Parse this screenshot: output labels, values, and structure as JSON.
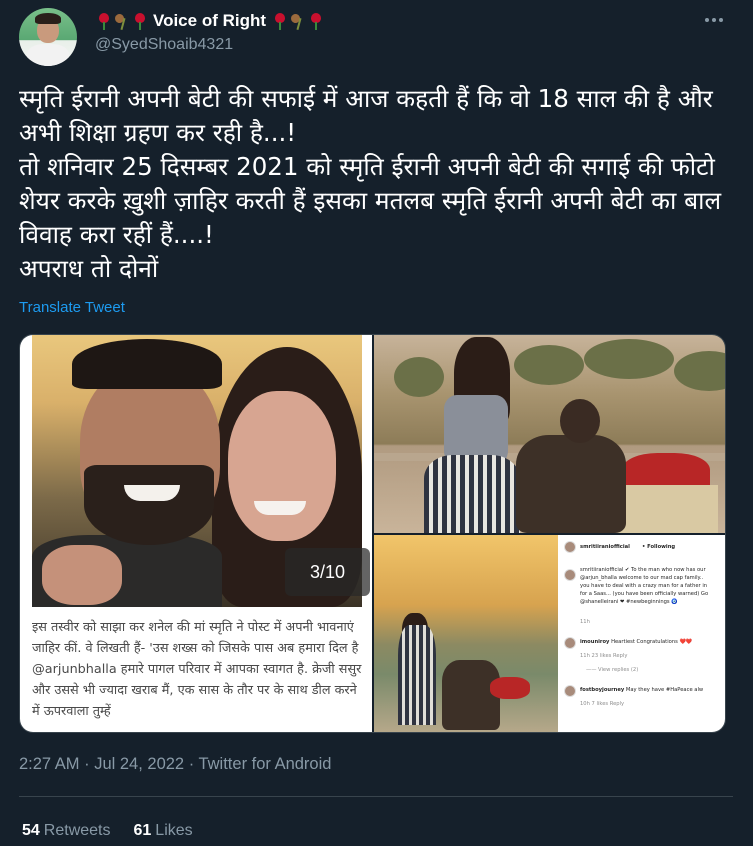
{
  "author": {
    "display_name": "Voice of Right",
    "handle": "@SyedShoaib4321",
    "name_emojis_left": [
      "rose",
      "wilted-flower",
      "rose"
    ],
    "name_emojis_right": [
      "rose",
      "wilted-flower",
      "rose"
    ]
  },
  "tweet": {
    "text": "स्मृति ईरानी अपनी बेटी की सफाई में आज कहती हैं कि वो 18 साल की है और अभी शिक्षा ग्रहण कर रही है...!\nतो शनिवार 25 दिसम्बर 2021 को स्मृति ईरानी अपनी बेटी की सगाई की फोटो शेयर करके ख़ुशी ज़ाहिर करती हैं इसका मतलब स्मृति ईरानी अपनी बेटी का बाल विवाह करा रहीं हैं....!\nअपराध तो दोनों",
    "translate_label": "Translate Tweet"
  },
  "media": {
    "photo_counter": "3/10",
    "caption": "इस तस्वीर को साझा कर शनेल की मां स्मृति ने पोस्ट में अपनी भावनाएं जाहिर कीं. वे लिखती हैं- 'उस शख्स को जिसके पास अब हमारा दिल है @arjunbhalla हमारे पागल परिवार में आपका स्वागत है. क्रेजी ससुर और उससे भी ज्यादा खराब मैं, एक सास के तौर पर  के साथ डील करने में ऊपरवाला तुम्हें",
    "instagram": {
      "account": "smritiiraniofficial",
      "following": "• Following",
      "post_lines": [
        "smritiiraniofficial ✔ To the man who now has our",
        "@arjun_bhalla welcome to our mad cap family..",
        "you have to deal with a crazy man for a father in",
        "for a Saas... (you have been officially warned) Go",
        "@shanelleirani ❤ #newbeginnings 🧿"
      ],
      "post_time": "11h",
      "comments": [
        {
          "user": "imouniroy",
          "text": "Heartiest Congratulations ❤️❤️",
          "meta": "11h   23 likes   Reply"
        },
        {
          "user": "fostboyjourney",
          "text": "May they have #HaPeace alw",
          "meta": "10h   7 likes   Reply"
        }
      ],
      "view_replies": "—— View replies (2)"
    }
  },
  "meta": {
    "timestamp": "2:27 AM · Jul 24, 2022 · Twitter for Android"
  },
  "stats": {
    "retweets_count": "54",
    "retweets_label": "Retweets",
    "likes_count": "61",
    "likes_label": "Likes"
  },
  "colors": {
    "background": "#15202b",
    "text": "#ffffff",
    "secondary": "#8899a6",
    "link": "#1d9bf0",
    "divider": "#38444d"
  }
}
